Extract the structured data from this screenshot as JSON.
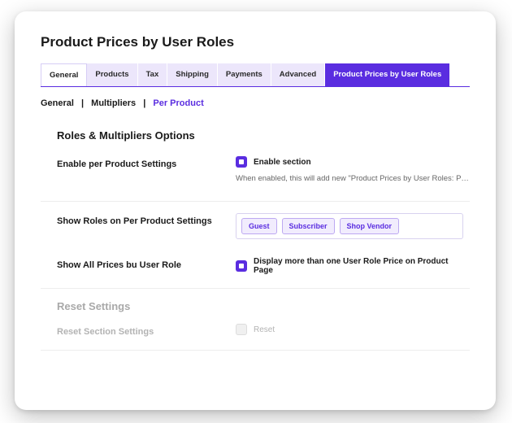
{
  "page_title": "Product Prices by User Roles",
  "tabs": [
    {
      "label": "General"
    },
    {
      "label": "Products"
    },
    {
      "label": "Tax"
    },
    {
      "label": "Shipping"
    },
    {
      "label": "Payments"
    },
    {
      "label": "Advanced"
    },
    {
      "label": "Product Prices by User Roles"
    }
  ],
  "subnav": {
    "item0": "General",
    "item1": "Multipliers",
    "item2": "Per Product"
  },
  "section1": {
    "heading": "Roles & Multipliers Options",
    "enable_row_label": "Enable per Product Settings",
    "enable_checkbox_label": "Enable section",
    "enable_description": "When enabled, this will add new \"Product Prices by User Roles: Per settings\"…",
    "show_roles_label": "Show Roles on Per Product Settings",
    "role_tags": [
      "Guest",
      "Subscriber",
      "Shop Vendor"
    ],
    "show_all_label": "Show All Prices bu User Role",
    "show_all_checkbox_label": "Display more than one User Role Price on Product Page"
  },
  "section2": {
    "heading": "Reset Settings",
    "reset_row_label": "Reset Section Settings",
    "reset_checkbox_label": "Reset"
  },
  "colors": {
    "accent": "#5a2de0",
    "tab_bg": "#ece6fb"
  }
}
